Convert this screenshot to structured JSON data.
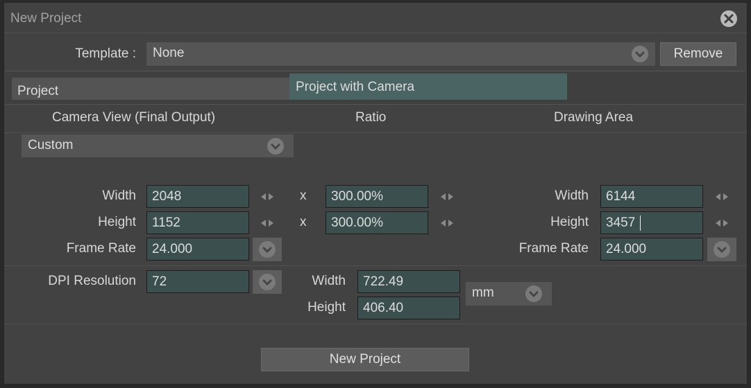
{
  "dialog": {
    "title": "New Project"
  },
  "template": {
    "label": "Template :",
    "value": "None",
    "remove_label": "Remove"
  },
  "tabs": [
    {
      "label": "Project"
    },
    {
      "label": "Project with Camera",
      "active": true
    }
  ],
  "sections": {
    "camera_view": "Camera View (Final Output)",
    "ratio": "Ratio",
    "drawing_area": "Drawing Area"
  },
  "preset": {
    "value": "Custom"
  },
  "camera": {
    "width_label": "Width",
    "width": "2048",
    "height_label": "Height",
    "height": "1152",
    "frame_rate_label": "Frame Rate",
    "frame_rate": "24.000"
  },
  "ratio": {
    "x_label": "x",
    "width": "300.00%",
    "height": "300.00%"
  },
  "drawing": {
    "width_label": "Width",
    "width": "6144",
    "height_label": "Height",
    "height": "3457",
    "frame_rate_label": "Frame Rate",
    "frame_rate": "24.000"
  },
  "dpi": {
    "label": "DPI Resolution",
    "value": "72"
  },
  "physical": {
    "width_label": "Width",
    "width": "722.49",
    "height_label": "Height",
    "height": "406.40",
    "unit": "mm"
  },
  "actions": {
    "new_project_label": "New Project"
  },
  "colors": {
    "background": "#424242",
    "field": "#3c4f4f",
    "active_tab": "#4a6363",
    "button": "#5c5c5c"
  },
  "icons": {
    "close": "close-icon",
    "dropdown": "chevron-down-icon",
    "arrows": "left-right-arrows-icon"
  }
}
